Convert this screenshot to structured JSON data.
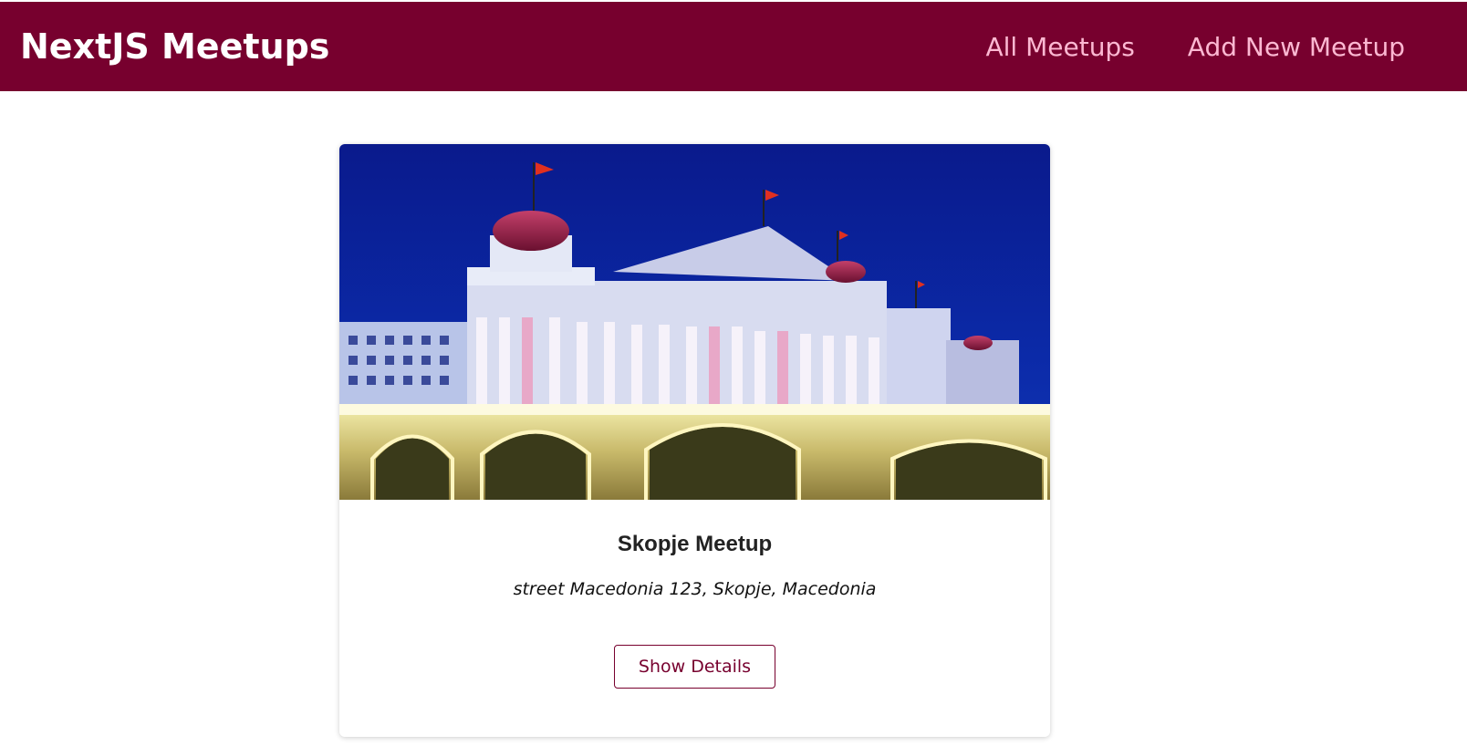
{
  "header": {
    "logo": "NextJS Meetups",
    "nav": [
      {
        "label": "All Meetups"
      },
      {
        "label": "Add New Meetup"
      }
    ]
  },
  "meetups": [
    {
      "image_icon": "skopje-photo",
      "title": "Skopje Meetup",
      "address": "street Macedonia 123, Skopje, Macedonia",
      "button_label": "Show Details"
    }
  ],
  "colors": {
    "brand": "#77002e",
    "nav_link": "#fcb8d2"
  }
}
